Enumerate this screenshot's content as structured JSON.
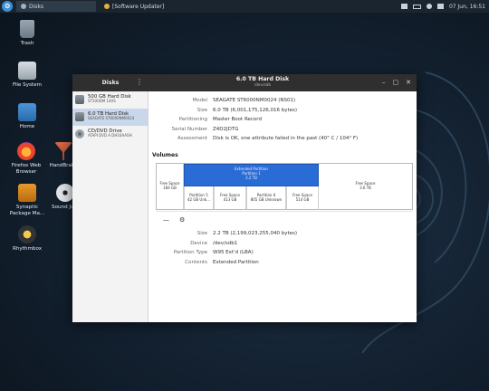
{
  "panel": {
    "start_glyph": "❂",
    "task1": "Disks",
    "task2": "[Software Updater]",
    "clock": "07 Jun, 16:51"
  },
  "desktop": {
    "icons": [
      {
        "label": "Trash"
      },
      {
        "label": "File System"
      },
      {
        "label": "Home"
      },
      {
        "label": "Firefox Web Browser"
      },
      {
        "label": "HandBrake"
      },
      {
        "label": "Synaptic Package Ma..."
      },
      {
        "label": "Sound Ju..."
      },
      {
        "label": "Rhythmbox"
      }
    ]
  },
  "window": {
    "app_title": "Disks",
    "menu_glyph": "⋮",
    "title": "6.0 TB Hard Disk",
    "subtitle": "/dev/sdb",
    "controls": {
      "minimize": "–",
      "maximize": "▢",
      "close": "✕"
    }
  },
  "drives": [
    {
      "name": "500 GB Hard Disk",
      "sub": "ST500DM 14AS"
    },
    {
      "name": "6.0 TB Hard Disk",
      "sub": "SEAGATE ST6000NM0024"
    },
    {
      "name": "CD/DVD Drive",
      "sub": "ATAPI   DVD A  DH16AASH"
    }
  ],
  "disk_info": [
    {
      "key": "Model",
      "value": "SEAGATE ST6000NM0024 (NS01)"
    },
    {
      "key": "Size",
      "value": "6.0 TB (6,001,175,126,016 bytes)"
    },
    {
      "key": "Partitioning",
      "value": "Master Boot Record"
    },
    {
      "key": "Serial Number",
      "value": "Z4D2JDTG"
    },
    {
      "key": "Assessment",
      "value": "Disk is OK, one attribute failed in the past (40° C / 104° F)"
    }
  ],
  "volumes": {
    "title": "Volumes",
    "free_left": {
      "l1": "Free Space",
      "l2": "184 GB"
    },
    "extended": {
      "l1": "Extended Partition",
      "l2": "Partition 1",
      "l3": "2.2 TB"
    },
    "parts": [
      {
        "l1": "Partition 5",
        "l2": "42 GB Unk..."
      },
      {
        "l1": "Free Space",
        "l2": "413 GB"
      },
      {
        "l1": "Partition 6",
        "l2": "805 GB Unknown"
      },
      {
        "l1": "Free Space",
        "l2": "514 GB"
      }
    ],
    "free_right": {
      "l1": "Free Space",
      "l2": "3.6 TB"
    },
    "tool_minus": "—",
    "tool_settings": "⚙"
  },
  "partition_info": [
    {
      "key": "Size",
      "value": "2.2 TB (2,199,023,255,040 bytes)"
    },
    {
      "key": "Device",
      "value": "/dev/sdb1"
    },
    {
      "key": "Partition Type",
      "value": "W95 Ext'd (LBA)"
    },
    {
      "key": "Contents",
      "value": "Extended Partition"
    }
  ]
}
